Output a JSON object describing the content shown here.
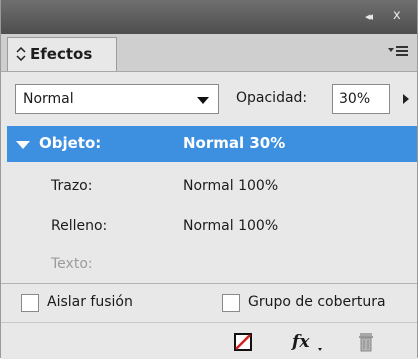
{
  "panel": {
    "title_bar": {
      "collapse_glyph": "◂◂",
      "close_glyph": "x"
    },
    "tab": {
      "label": "Efectos"
    },
    "blend_mode": {
      "value": "Normal"
    },
    "opacity": {
      "label": "Opacidad:",
      "value": "30%"
    },
    "levels": [
      {
        "name": "Objeto:",
        "value": "Normal 30%"
      },
      {
        "name": "Trazo:",
        "value": "Normal 100%"
      },
      {
        "name": "Relleno:",
        "value": "Normal 100%"
      },
      {
        "name": "Texto:",
        "value": ""
      }
    ],
    "options": {
      "isolate_blending": "Aislar fusión",
      "knockout_group": "Grupo de cobertura"
    },
    "toolbar": {
      "fx_glyph": "fx"
    }
  },
  "colors": {
    "selection": "#3d8fe0",
    "panel_bg": "#e8e8e8",
    "title_bar": "#5a5a5a",
    "disabled_text": "#9b9b9b",
    "clear_red": "#d42020"
  },
  "icons": {
    "collapse": "double-chevron-left-icon",
    "close": "close-icon",
    "tab_arrows": "up-down-arrows-icon",
    "panel_menu": "panel-menu-icon",
    "dropdown": "chevron-down-icon",
    "opacity_slider": "triangle-right-icon",
    "disclosure": "disclosure-triangle-icon",
    "clear": "clear-effects-icon",
    "fx": "fx-icon",
    "delete": "trash-icon"
  }
}
